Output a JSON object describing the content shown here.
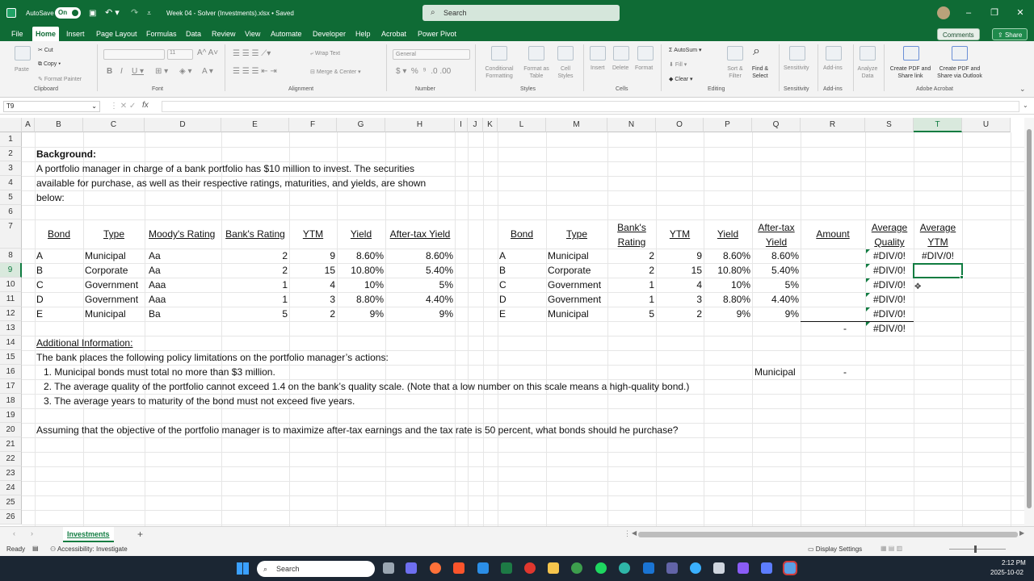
{
  "titlebar": {
    "autosave": "AutoSave",
    "toggle": "On",
    "filename": "Week 04 - Solver (Investments).xlsx • Saved",
    "search_placeholder": "Search"
  },
  "menu": [
    "File",
    "Home",
    "Insert",
    "Page Layout",
    "Formulas",
    "Data",
    "Review",
    "View",
    "Automate",
    "Developer",
    "Help",
    "Acrobat",
    "Power Pivot"
  ],
  "topbuttons": {
    "comments": "Comments",
    "share": "Share"
  },
  "ribbon": {
    "clipboard": {
      "paste": "Paste",
      "cut": "Cut",
      "copy": "Copy",
      "format_painter": "Format Painter",
      "label": "Clipboard"
    },
    "font": {
      "name": "",
      "size": "11",
      "label": "Font"
    },
    "alignment": {
      "wrap": "Wrap Text",
      "merge": "Merge & Center",
      "label": "Alignment"
    },
    "number": {
      "format": "General",
      "label": "Number"
    },
    "styles": {
      "cond": "Conditional Formatting",
      "table": "Format as Table",
      "cell": "Cell Styles",
      "label": "Styles"
    },
    "cells": {
      "insert": "Insert",
      "delete": "Delete",
      "format": "Format",
      "label": "Cells"
    },
    "editing": {
      "autosum": "AutoSum",
      "fill": "Fill",
      "clear": "Clear",
      "sort": "Sort & Filter",
      "find": "Find & Select",
      "label": "Editing"
    },
    "sensitivity": {
      "item": "Sensitivity",
      "label": "Sensitivity"
    },
    "addins": {
      "item": "Add-ins",
      "label": "Add-ins"
    },
    "analyze": "Analyze Data",
    "acrobat": {
      "pdf": "Create PDF and Share link",
      "pdf_outlook": "Create PDF and Share via Outlook",
      "label": "Adobe Acrobat"
    }
  },
  "formula_bar": {
    "name_box": "T9",
    "fx": "fx",
    "formula": ""
  },
  "columns": [
    "A",
    "B",
    "C",
    "D",
    "E",
    "F",
    "G",
    "H",
    "I",
    "J",
    "K",
    "L",
    "M",
    "N",
    "O",
    "P",
    "Q",
    "R",
    "S",
    "T",
    "U"
  ],
  "rows": [
    "1",
    "2",
    "3",
    "4",
    "5",
    "6",
    "7",
    "8",
    "9",
    "10",
    "11",
    "12",
    "13",
    "14",
    "15",
    "16",
    "17",
    "18",
    "19",
    "20",
    "21",
    "22",
    "23",
    "24",
    "25",
    "26"
  ],
  "sheet": {
    "background_title": "Background:",
    "background_lines": [
      "A portfolio manager in charge of a bank portfolio has $10 million to invest. The securities",
      "available for purchase, as well as their respective ratings, maturities, and yields, are shown",
      "below:"
    ],
    "left_headers": [
      "Bond",
      "Type",
      "Moody's Rating",
      "Bank's Rating",
      "YTM",
      "Yield",
      "After-tax Yield"
    ],
    "left_rows": [
      [
        "A",
        "Municipal",
        "Aa",
        "2",
        "9",
        "8.60%",
        "8.60%"
      ],
      [
        "B",
        "Corporate",
        "Aa",
        "2",
        "15",
        "10.80%",
        "5.40%"
      ],
      [
        "C",
        "Government",
        "Aaa",
        "1",
        "4",
        "10%",
        "5%"
      ],
      [
        "D",
        "Government",
        "Aaa",
        "1",
        "3",
        "8.80%",
        "4.40%"
      ],
      [
        "E",
        "Municipal",
        "Ba",
        "5",
        "2",
        "9%",
        "9%"
      ]
    ],
    "right_headers": {
      "bond": "Bond",
      "type": "Type",
      "bank1": "Bank's",
      "bank2": "Rating",
      "ytm": "YTM",
      "yield": "Yield",
      "at1": "After-tax",
      "at2": "Yield",
      "amount": "Amount",
      "aq1": "Average",
      "aq2": "Quality",
      "ay1": "Average",
      "ay2": "YTM"
    },
    "right_rows": [
      [
        "A",
        "Municipal",
        "2",
        "9",
        "8.60%",
        "8.60%",
        "",
        "#DIV/0!",
        "#DIV/0!"
      ],
      [
        "B",
        "Corporate",
        "2",
        "15",
        "10.80%",
        "5.40%",
        "",
        "#DIV/0!",
        ""
      ],
      [
        "C",
        "Government",
        "1",
        "4",
        "10%",
        "5%",
        "",
        "#DIV/0!",
        ""
      ],
      [
        "D",
        "Government",
        "1",
        "3",
        "8.80%",
        "4.40%",
        "",
        "#DIV/0!",
        ""
      ],
      [
        "E",
        "Municipal",
        "5",
        "2",
        "9%",
        "9%",
        "",
        "#DIV/0!",
        ""
      ]
    ],
    "total_amount": "-",
    "total_quality": "#DIV/0!",
    "additional_title": "Additional Information:",
    "additional_intro": "The bank places the following policy limitations on the portfolio manager’s actions:",
    "limits": [
      "1. Municipal bonds must total no more than $3 million.",
      "2. The average quality of the portfolio cannot exceed 1.4 on the bank’s quality scale. (Note that a low number on this scale means a high-quality bond.)",
      "3. The average years to maturity of the bond must not exceed five years."
    ],
    "municipal_label": "Municipal",
    "municipal_value": "-",
    "question": "Assuming that the objective of the portfolio manager is to maximize after-tax earnings and the tax rate is 50 percent, what bonds should he purchase?"
  },
  "tabs": {
    "sheet": "Investments",
    "add": "+"
  },
  "status": {
    "ready": "Ready",
    "accessibility": "Accessibility: Investigate",
    "display": "Display Settings"
  },
  "taskbar": {
    "search": "Search",
    "time": "2:12 PM",
    "date": "2025-10-02"
  }
}
